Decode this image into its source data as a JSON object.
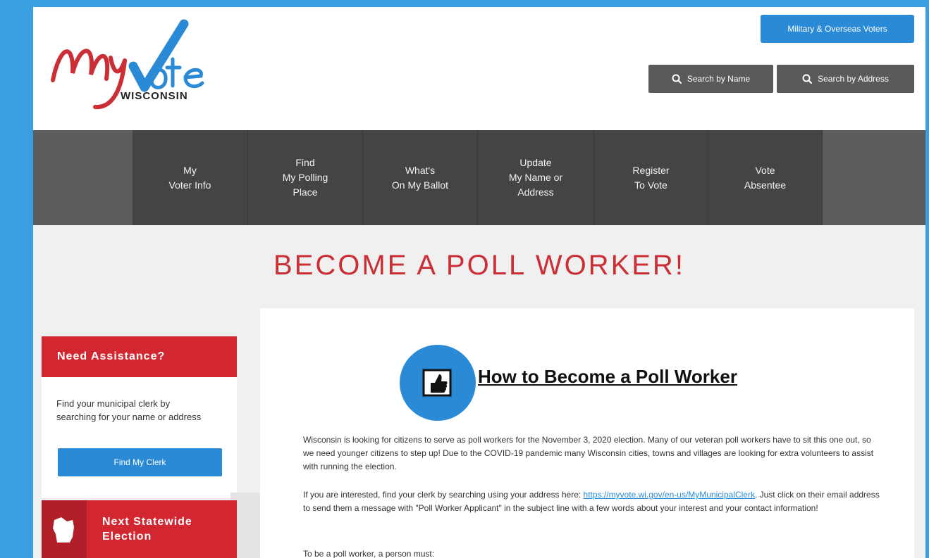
{
  "colors": {
    "frame": "#3a9fe0",
    "accent_blue": "#2a8ad6",
    "brand_red": "#cc2e35",
    "nav_dark": "#444444"
  },
  "header": {
    "logo": {
      "script_text": "MyVote",
      "state_text": "WISCONSIN"
    },
    "military_button": "Military & Overseas Voters",
    "search_by_name": "Search by Name",
    "search_by_address": "Search by Address",
    "search_icon": "search-icon"
  },
  "nav": {
    "items": [
      {
        "label": "My\nVoter Info"
      },
      {
        "label": "Find\nMy Polling\nPlace"
      },
      {
        "label": "What's\nOn My Ballot"
      },
      {
        "label": "Update\nMy Name or\nAddress"
      },
      {
        "label": "Register\nTo Vote"
      },
      {
        "label": "Vote\nAbsentee"
      }
    ]
  },
  "page_title": "BECOME A POLL WORKER!",
  "sidebar": {
    "assist_heading": "Need Assistance?",
    "assist_text": "Find your municipal clerk by searching for your name or address",
    "find_clerk_button": "Find My Clerk",
    "election_heading": "Next Statewide\nElection",
    "election_icon": "wisconsin-map-icon"
  },
  "content": {
    "icon": "thumbs-up-ballot-icon",
    "heading": "How to Become a Poll Worker",
    "paragraph1": "Wisconsin is looking for citizens to serve as poll workers for the November 3, 2020 election.  Many of our veteran poll workers have to sit this one out, so we need younger citizens to step up!  Due to the COVID-19 pandemic many Wisconsin cities, towns and villages are looking for extra volunteers to assist with running the election.",
    "paragraph2_before": "If you are interested, find your clerk by searching using your address here: ",
    "paragraph2_link": "https://myvote.wi.gov/en-us/MyMunicipalClerk",
    "paragraph2_after": ".  Just click on their email address to send them a message with \"Poll Worker Applicant\" in the subject line with a few words about your interest and your contact information!",
    "paragraph3": "To be a poll worker, a person must:"
  }
}
